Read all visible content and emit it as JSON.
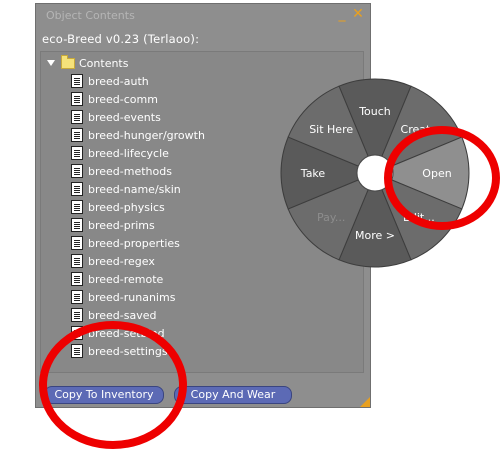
{
  "window": {
    "title": "Object Contents",
    "minimize_icon": "minimize-icon",
    "close_icon": "close-icon",
    "heading": "eco-Breed v0.23 (Terlaoo):"
  },
  "tree": {
    "root_label": "Contents",
    "items": [
      "breed-auth",
      "breed-comm",
      "breed-events",
      "breed-hunger/growth",
      "breed-lifecycle",
      "breed-methods",
      "breed-name/skin",
      "breed-physics",
      "breed-prims",
      "breed-properties",
      "breed-regex",
      "breed-remote",
      "breed-runanims",
      "breed-saved",
      "breed-setbind",
      "breed-settings"
    ]
  },
  "buttons": {
    "copy_to_inventory": "Copy To Inventory",
    "copy_and_wear": "Copy And Wear"
  },
  "pie_menu": {
    "touch": "Touch",
    "create": "Create",
    "open": "Open",
    "edit": "Edit...",
    "more": "More >",
    "pay": "Pay...",
    "take": "Take",
    "sit_here": "Sit Here"
  },
  "colors": {
    "window_bg": "#8e8e8e",
    "button_bg": "#5c6ab5",
    "highlight_ring": "#ee0000",
    "pie_dark": "#5a5a5a",
    "pie_light": "#8f8f8f"
  }
}
